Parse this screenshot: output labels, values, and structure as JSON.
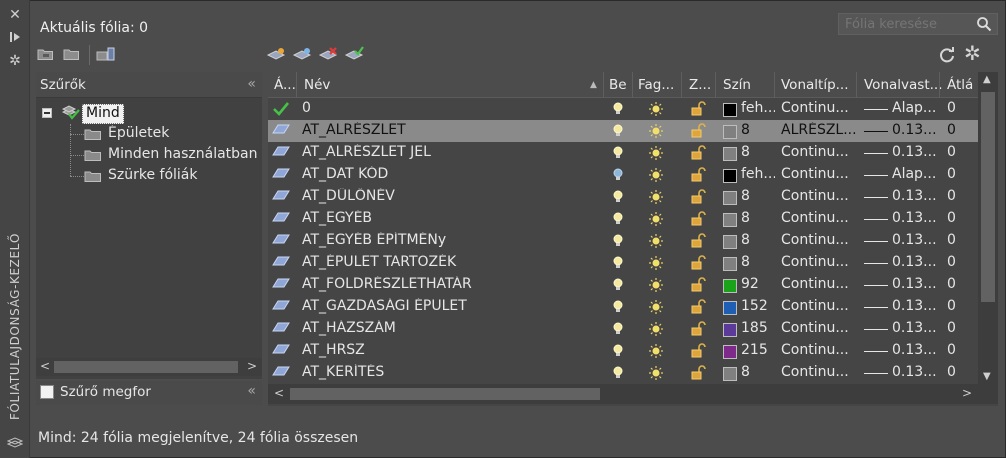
{
  "titlebar": {
    "vertical_title": "FÓLIATULAJDONSÁG-KEZELŐ",
    "close_icon": "close-icon",
    "pin_icon": "pin-icon",
    "settings_icon": "gear-icon"
  },
  "header": {
    "current_layer": "Aktuális fólia: 0",
    "search_placeholder": "Fólia keresése"
  },
  "filters": {
    "title": "Szűrők",
    "root": "Mind",
    "items": [
      "Épületek",
      "Minden használatban lé",
      "Szürke fóliák"
    ],
    "invert_label": "Szűrő megfor"
  },
  "columns": {
    "status": "Á...",
    "name": "Név",
    "on": "Be",
    "freeze": "Fag...",
    "lock": "Z...",
    "color": "Szín",
    "linetype": "Vonaltíp...",
    "lineweight": "Vonalvast...",
    "transparency": "Átlá"
  },
  "layers": [
    {
      "name": "0",
      "status": "current",
      "on": "on",
      "color_name": "feh...",
      "color": "#000000",
      "linetype": "Continu...",
      "lineweight": "Alap...",
      "transparency": "0"
    },
    {
      "name": "AT_ALRÉSZLET",
      "status": "layer",
      "on": "on",
      "color_name": "8",
      "color": "#808080",
      "linetype": "ALRÉSZL...",
      "lineweight": "0.13...",
      "transparency": "0",
      "selected": true
    },
    {
      "name": "AT_ALRÉSZLET JEL",
      "status": "layer",
      "on": "on",
      "color_name": "8",
      "color": "#808080",
      "linetype": "Continu...",
      "lineweight": "0.13...",
      "transparency": "0"
    },
    {
      "name": "AT_DAT KÓD",
      "status": "layer",
      "on": "off",
      "color_name": "feh...",
      "color": "#000000",
      "linetype": "Continu...",
      "lineweight": "Alap...",
      "transparency": "0"
    },
    {
      "name": "AT_DŰLŐNÉV",
      "status": "layer",
      "on": "on",
      "color_name": "8",
      "color": "#808080",
      "linetype": "Continu...",
      "lineweight": "0.13...",
      "transparency": "0"
    },
    {
      "name": "AT_EGYÉB",
      "status": "layer",
      "on": "on",
      "color_name": "8",
      "color": "#808080",
      "linetype": "Continu...",
      "lineweight": "0.13...",
      "transparency": "0"
    },
    {
      "name": "AT_EGYÉB ÉPÍTMÉNy",
      "status": "layer",
      "on": "on",
      "color_name": "8",
      "color": "#808080",
      "linetype": "Continu...",
      "lineweight": "0.13...",
      "transparency": "0"
    },
    {
      "name": "AT_ÉPÜLET TARTOZÉK",
      "status": "layer",
      "on": "on",
      "color_name": "8",
      "color": "#808080",
      "linetype": "Continu...",
      "lineweight": "0.13...",
      "transparency": "0"
    },
    {
      "name": "AT_FÖLDRÉSZLETHATÁR",
      "status": "layer",
      "on": "on",
      "color_name": "92",
      "color": "#1aa21a",
      "linetype": "Continu...",
      "lineweight": "0.13...",
      "transparency": "0"
    },
    {
      "name": "AT_GAZDASÁGI ÉPÜLET",
      "status": "layer",
      "on": "on",
      "color_name": "152",
      "color": "#1f5fb3",
      "linetype": "Continu...",
      "lineweight": "0.13...",
      "transparency": "0"
    },
    {
      "name": "AT_HÁZSZÁM",
      "status": "layer",
      "on": "on",
      "color_name": "185",
      "color": "#5b3a9a",
      "linetype": "Continu...",
      "lineweight": "0.13...",
      "transparency": "0"
    },
    {
      "name": "AT_HRSZ",
      "status": "layer",
      "on": "on",
      "color_name": "215",
      "color": "#7d2a8a",
      "linetype": "Continu...",
      "lineweight": "0.13...",
      "transparency": "0"
    },
    {
      "name": "AT_KERÍTÉS",
      "status": "layer",
      "on": "on",
      "color_name": "8",
      "color": "#808080",
      "linetype": "Continu...",
      "lineweight": "0.13...",
      "transparency": "0"
    }
  ],
  "status_bar": "Mind: 24 fólia megjelenítve, 24 fólia összesen"
}
